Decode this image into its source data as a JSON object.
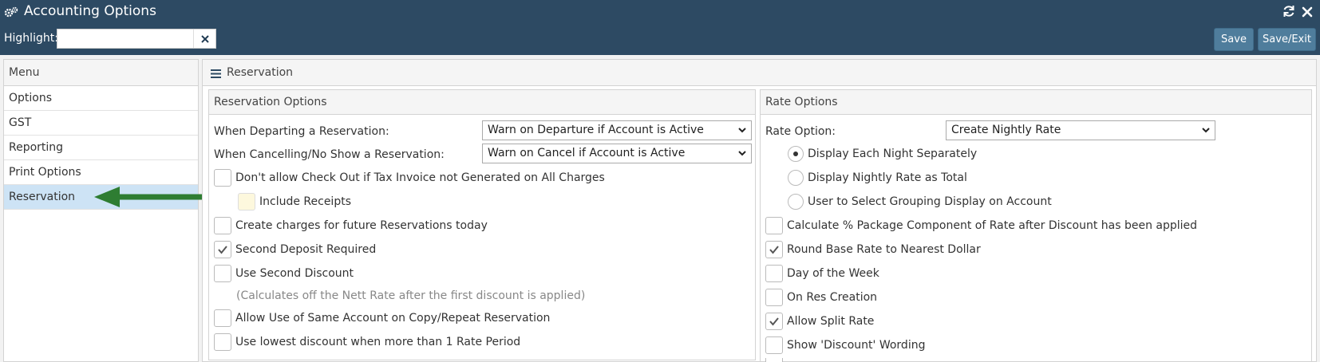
{
  "window": {
    "title": "Accounting Options",
    "title_icon": "gears-icon",
    "refresh_icon": "refresh-icon",
    "close_icon": "close-icon"
  },
  "toolbar": {
    "highlight_label": "Highlight:",
    "highlight_value": "",
    "highlight_placeholder": "",
    "save_label": "Save",
    "save_exit_label": "Save/Exit"
  },
  "menu": {
    "header": "Menu",
    "items": [
      {
        "label": "Options"
      },
      {
        "label": "GST"
      },
      {
        "label": "Reporting"
      },
      {
        "label": "Print Options"
      },
      {
        "label": "Reservation",
        "active": true
      }
    ]
  },
  "main": {
    "title": "Reservation"
  },
  "reservation_options": {
    "header": "Reservation Options",
    "departing_label": "When Departing a Reservation:",
    "departing_value": "Warn on Departure if Account is Active",
    "cancelling_label": "When Cancelling/No Show a Reservation:",
    "cancelling_value": "Warn on Cancel if Account is Active",
    "checkboxes": [
      {
        "label": "Don't allow Check Out if Tax Invoice not Generated on All Charges",
        "checked": false
      },
      {
        "label": "Include Receipts",
        "checked": false
      },
      {
        "label": "Create charges for future Reservations today",
        "checked": false
      },
      {
        "label": "Second Deposit Required",
        "checked": true
      },
      {
        "label": "Use Second Discount",
        "checked": false
      },
      {
        "label": "Allow Use of Same Account on Copy/Repeat Reservation",
        "checked": false
      },
      {
        "label": "Use lowest discount when more than 1 Rate Period",
        "checked": false
      }
    ],
    "second_discount_note": "(Calculates off the Nett Rate after the first discount is applied)"
  },
  "rate_options": {
    "header": "Rate Options",
    "rate_option_label": "Rate Option:",
    "rate_option_value": "Create Nightly Rate",
    "radios": [
      {
        "label": "Display Each Night Separately",
        "selected": true
      },
      {
        "label": "Display Nightly Rate as Total",
        "selected": false
      },
      {
        "label": "User to Select Grouping Display on Account",
        "selected": false
      }
    ],
    "checkboxes": [
      {
        "label": "Calculate % Package Component of Rate after Discount has been applied",
        "checked": false
      },
      {
        "label": "Round Base Rate to Nearest Dollar",
        "checked": true
      },
      {
        "label": "Day of the Week",
        "checked": false
      },
      {
        "label": "On Res Creation",
        "checked": false
      },
      {
        "label": "Allow Split Rate",
        "checked": true
      },
      {
        "label": "Show 'Discount' Wording",
        "checked": false
      }
    ]
  },
  "colors": {
    "topbar": "#2d4a63",
    "button": "#4f7d9c",
    "active_menu": "#cde3f5",
    "arrow": "#2e7d32"
  }
}
